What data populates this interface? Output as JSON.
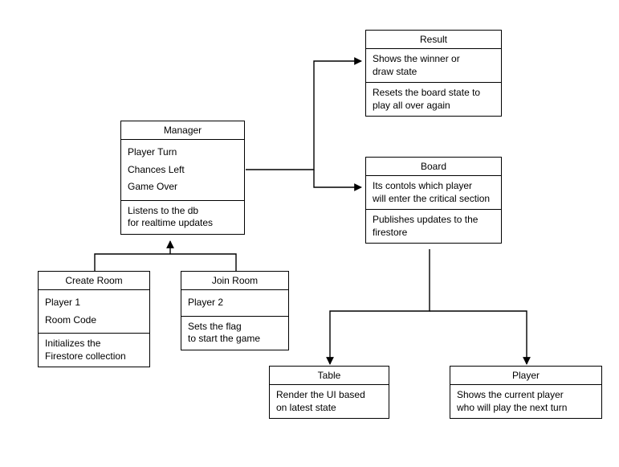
{
  "manager": {
    "title": "Manager",
    "attr1": "Player Turn",
    "attr2": "Chances Left",
    "attr3": "Game Over",
    "note": "Listens to the db\nfor realtime updates"
  },
  "result": {
    "title": "Result",
    "note1": "Shows the winner or\ndraw state",
    "note2": "Resets the board state to\nplay all over again"
  },
  "board": {
    "title": "Board",
    "note1": "Its contols which player\nwill enter the critical section",
    "note2": "Publishes updates to the\nfirestore"
  },
  "createRoom": {
    "title": "Create Room",
    "attr1": "Player 1",
    "attr2": "Room Code",
    "note": "Initializes the\nFirestore collection"
  },
  "joinRoom": {
    "title": "Join Room",
    "attr1": "Player 2",
    "note": "Sets the flag\nto start the game"
  },
  "table": {
    "title": "Table",
    "note": "Render the UI based\non latest state"
  },
  "player": {
    "title": "Player",
    "note": "Shows the current player\nwho will play the next turn"
  }
}
